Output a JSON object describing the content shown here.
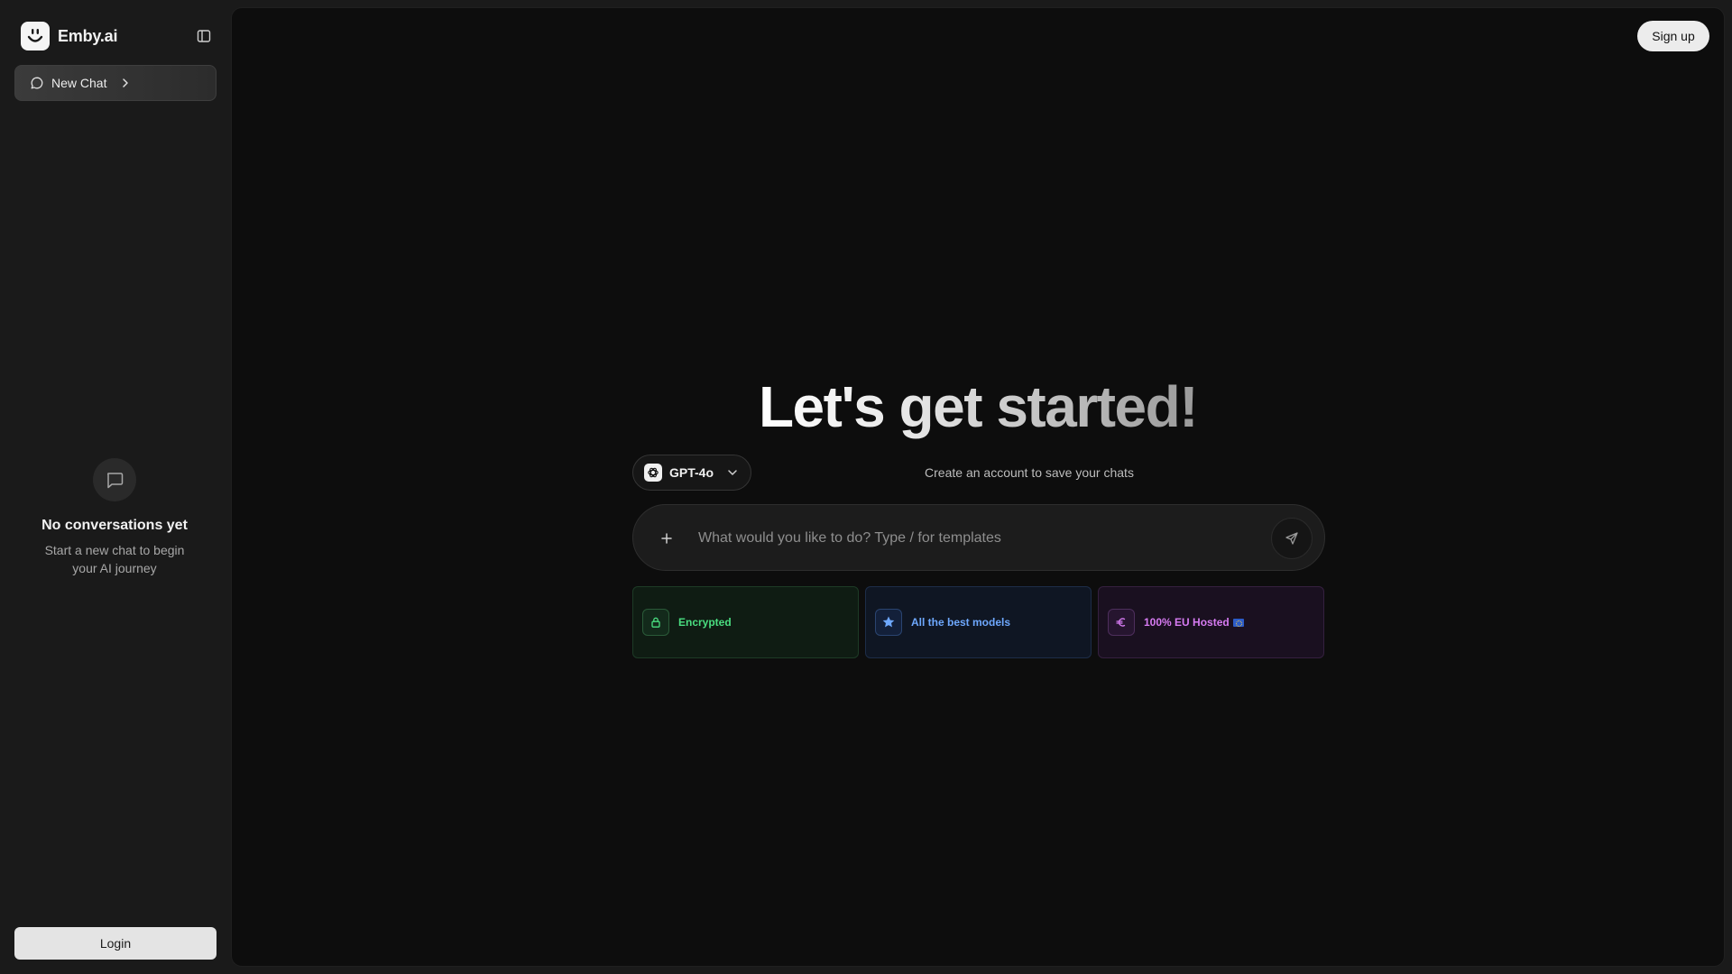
{
  "app": {
    "name": "Emby.ai",
    "icons": {
      "logo": "smiley-logo-icon",
      "collapse": "sidebar-toggle-icon",
      "new_chat": "chat-bubble-icon",
      "new_chat_arrow": "chevron-right-icon",
      "empty": "message-square-icon"
    }
  },
  "sidebar": {
    "new_chat_label": "New Chat",
    "empty_state": {
      "title": "No conversations yet",
      "subtitle": "Start a new chat to begin your AI journey"
    },
    "login_label": "Login"
  },
  "header": {
    "signup_label": "Sign up"
  },
  "main": {
    "hero_title": "Let's get started!",
    "model_selector": {
      "label": "GPT-4o",
      "icon": "openai-icon"
    },
    "save_hint": "Create an account to save your chats",
    "composer": {
      "placeholder": "What would you like to do? Type / for templates",
      "value": "",
      "add_icon": "plus-icon",
      "send_icon": "send-icon"
    },
    "features": [
      {
        "label": "Encrypted",
        "icon": "lock-icon",
        "color": "#4ade80"
      },
      {
        "label": "All the best models",
        "icon": "star-icon",
        "color": "#6ea8fe"
      },
      {
        "label": "100% EU Hosted",
        "icon": "euro-icon",
        "color": "#d77bf2"
      }
    ]
  }
}
